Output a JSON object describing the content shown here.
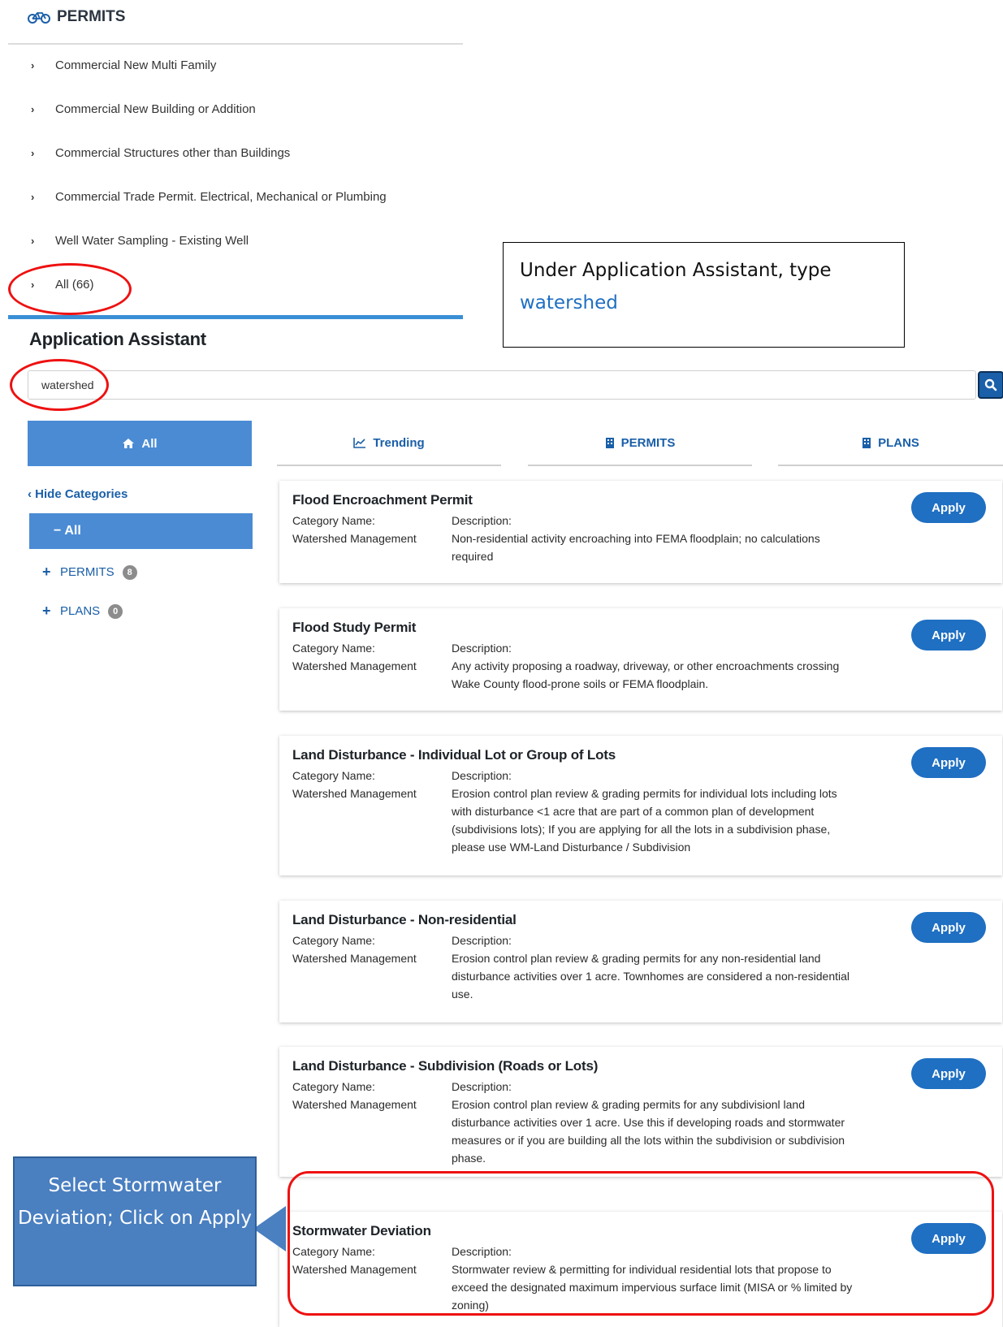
{
  "permits_section": {
    "title": "PERMITS",
    "items": [
      {
        "label": "Commercial New Multi Family"
      },
      {
        "label": "Commercial New Building or Addition"
      },
      {
        "label": "Commercial Structures other than Buildings"
      },
      {
        "label": "Commercial Trade Permit. Electrical, Mechanical or Plumbing"
      },
      {
        "label": "Well Water Sampling - Existing Well"
      },
      {
        "label": "All (66)"
      }
    ]
  },
  "app_assistant": {
    "title": "Application Assistant",
    "search_value": "watershed"
  },
  "tabs": [
    {
      "label": "All",
      "icon": "home-icon",
      "active": true
    },
    {
      "label": "Trending",
      "icon": "trend-chart-icon",
      "active": false
    },
    {
      "label": "PERMITS",
      "icon": "building-icon",
      "active": false
    },
    {
      "label": "PLANS",
      "icon": "building-icon",
      "active": false
    }
  ],
  "sidebar": {
    "hide_label": "Hide Categories",
    "all_label": "All",
    "categories": [
      {
        "label": "PERMITS",
        "count": "8"
      },
      {
        "label": "PLANS",
        "count": "0"
      }
    ]
  },
  "card_labels": {
    "category_name": "Category Name:",
    "description": "Description:",
    "apply": "Apply"
  },
  "results": [
    {
      "title": "Flood Encroachment Permit",
      "category": "Watershed Management",
      "description": "Non-residential activity encroaching into FEMA floodplain; no calculations required"
    },
    {
      "title": "Flood Study Permit",
      "category": "Watershed Management",
      "description": "Any activity proposing a roadway, driveway, or other encroachments crossing Wake County flood-prone soils or FEMA floodplain."
    },
    {
      "title": "Land Disturbance - Individual Lot or Group of Lots",
      "category": "Watershed Management",
      "description": "Erosion control plan review & grading permits for individual lots including lots with disturbance <1 acre that are part of a common plan of development (subdivisions lots); If you are applying for all the lots in a subdivision phase, please use WM-Land Disturbance / Subdivision"
    },
    {
      "title": "Land Disturbance - Non-residential",
      "category": "Watershed Management",
      "description": "Erosion control plan review & grading permits for any non-residential land disturbance activities over 1 acre. Townhomes are considered a non-residential use."
    },
    {
      "title": "Land Disturbance - Subdivision (Roads or Lots)",
      "category": "Watershed Management",
      "description": "Erosion control plan review & grading permits for any subdivisionl land disturbance activities over 1 acre. Use this if developing roads and stormwater measures or if you are building all the lots within the subdivision or subdivision phase."
    },
    {
      "title": "Stormwater Deviation",
      "category": "Watershed Management",
      "description": "Stormwater review & permitting for individual residential lots that propose to exceed the designated maximum impervious surface limit (MISA or % limited by zoning)"
    }
  ],
  "callouts": {
    "search_instruction": "Under Application Assistant, type",
    "search_keyword": "watershed",
    "select_instruction": "Select Stormwater Deviation; Click on Apply"
  },
  "colors": {
    "accent": "#4a8bd4",
    "link": "#1a5fa8",
    "button": "#1f6fc2",
    "highlight": "#ee1111",
    "callout": "#4a7fc0"
  }
}
